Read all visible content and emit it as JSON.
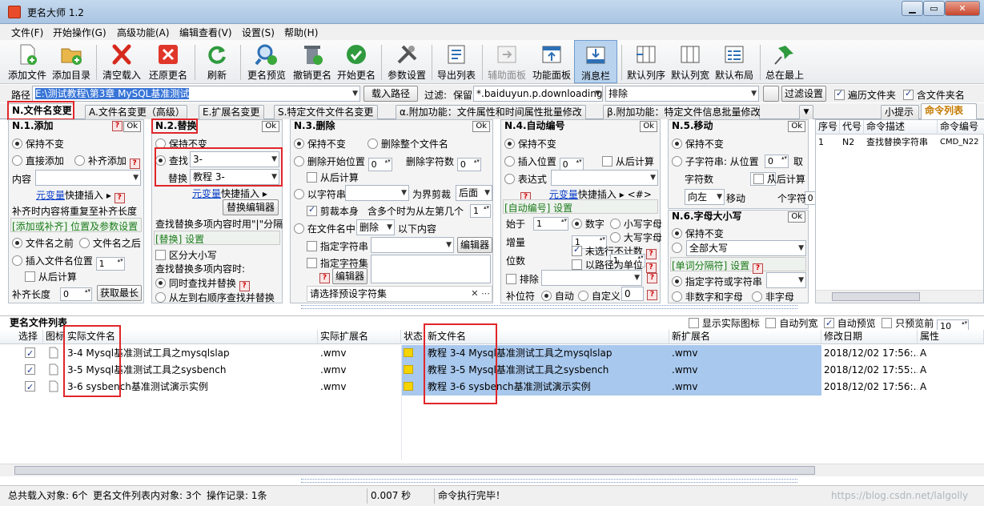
{
  "window": {
    "title": "更名大师 1.2",
    "min": "▁",
    "max": "▭",
    "close": "✕"
  },
  "menu": [
    "文件(F)",
    "开始操作(G)",
    "高级功能(A)",
    "编辑查看(V)",
    "设置(S)",
    "帮助(H)"
  ],
  "toolbar": [
    {
      "label": "添加文件",
      "icon": "add-file-icon"
    },
    {
      "label": "添加目录",
      "icon": "add-folder-icon"
    },
    {
      "label": "清空载入",
      "icon": "clear-icon"
    },
    {
      "label": "还原更名",
      "icon": "undo-rename-icon"
    },
    {
      "label": "刷新",
      "icon": "refresh-icon"
    },
    {
      "label": "更名预览",
      "icon": "preview-icon"
    },
    {
      "label": "撤销更名",
      "icon": "trash-icon"
    },
    {
      "label": "开始更名",
      "icon": "start-icon"
    },
    {
      "label": "参数设置",
      "icon": "tools-icon"
    },
    {
      "label": "导出列表",
      "icon": "export-icon"
    },
    {
      "label": "辅助面板",
      "icon": "aux-panel-icon"
    },
    {
      "label": "功能面板",
      "icon": "func-panel-icon"
    },
    {
      "label": "消息栏",
      "icon": "message-icon"
    },
    {
      "label": "默认列序",
      "icon": "col-order-icon"
    },
    {
      "label": "默认列宽",
      "icon": "col-width-icon"
    },
    {
      "label": "默认布局",
      "icon": "layout-icon"
    },
    {
      "label": "总在最上",
      "icon": "pin-icon"
    }
  ],
  "pathbar": {
    "path_label": "路径",
    "path_value": "E:\\测试教程\\第3章 MySQL基准测试",
    "load_path": "载入路径",
    "filter_label": "过滤:",
    "keep_label": "保留",
    "keep_value": "*.baiduyun.p.downloading",
    "exclude_value": "排除",
    "filter_btn": "过滤设置",
    "traverse": "遍历文件夹",
    "include_dir": "含文件夹名"
  },
  "tabs": [
    "N.文件名变更",
    "A.文件名变更（高级）",
    "E.扩展名变更",
    "S.特定文件文件名变更",
    "α.附加功能：文件属性和时间属性批量修改",
    "β.附加功能：特定文件信息批量修改"
  ],
  "right_tabs": [
    "小提示",
    "命令列表"
  ],
  "p1": {
    "title": "N.1.添加",
    "ok": "Ok",
    "q": "?",
    "keep": "保持不变",
    "direct": "直接添加",
    "pad": "补齐添加",
    "content": "内容",
    "var_link": "元变量",
    "quick_insert": "快捷插入",
    "repeat_note": "补齐时内容将重复至补齐长度",
    "pos_title": "[添加或补齐] 位置及参数设置",
    "before": "文件名之前",
    "after": "文件名之后",
    "insert_pos": "插入文件名位置",
    "insert_val": "1",
    "from_back": "从后计算",
    "pad_len": "补齐长度",
    "pad_val": "0",
    "get_max": "获取最长"
  },
  "p2": {
    "title": "N.2.替换",
    "ok": "Ok",
    "keep": "保持不变",
    "find": "查找",
    "find_val": "3-",
    "replace": "替换",
    "replace_val": "教程 3-",
    "var_link": "元变量",
    "quick_insert": "快捷插入",
    "editor": "替换编辑器",
    "multi_note": "查找替换多项内容时用\"|\"分隔",
    "settings_title": "[替换] 设置",
    "case": "区分大小写",
    "multi_when": "查找替换多项内容时:",
    "simul": "同时查找并替换",
    "seq": "从左到右顺序查找并替换"
  },
  "p3": {
    "title": "N.3.删除",
    "ok": "Ok",
    "keep": "保持不变",
    "del_all": "删除整个文件名",
    "del_start": "删除开始位置",
    "start_val": "0",
    "del_count": "删除字符数",
    "count_val": "0",
    "from_back": "从后计算",
    "by_str": "以字符串",
    "by_str_sel": "",
    "cut_label": "为界剪裁",
    "cut_dir": "后面",
    "cut_self": "剪裁本身",
    "multi_note": "含多个时为从左第几个",
    "multi_val": "1",
    "in_name": "在文件名中",
    "in_name_sel": "删除",
    "below": "以下内容",
    "spec_str": "指定字符串",
    "editor": "编辑器",
    "spec_set": "指定字符集",
    "editor2": "编辑器",
    "preset": "请选择预设字符集"
  },
  "p4": {
    "title": "N.4.自动编号",
    "ok": "Ok",
    "keep": "保持不变",
    "insert_pos": "插入位置",
    "insert_val": "0",
    "from_back": "从后计算",
    "expr": "表达式",
    "var_link": "元变量",
    "quick_insert": "快捷插入",
    "hash": "<#>",
    "settings_title": "[自动编号] 设置",
    "start": "始于",
    "start_val": "1",
    "inc": "增量",
    "inc_val": "1",
    "digits": "位数",
    "digits_val": "1",
    "num": "数字",
    "lower": "小写字母",
    "upper": "大写字母",
    "skip_unselected": "未选行不计数",
    "path_unit": "以路径为单位",
    "exclude": "排除",
    "pad_char": "补位符",
    "auto": "自动",
    "custom": "自定义",
    "custom_val": "0"
  },
  "p5": {
    "title": "N.5.移动",
    "ok": "Ok",
    "keep": "保持不变",
    "substr": "子字符串: 从位置",
    "substr_val": "0",
    "take": "取",
    "chars": "字符数",
    "chars_val": "0",
    "from_back": "从后计算",
    "dir": "向左",
    "move": "移动",
    "move_val": "0",
    "unit": "个字符"
  },
  "p6": {
    "title": "N.6.字母大小写",
    "ok": "Ok",
    "keep": "保持不变",
    "case_sel": "全部大写",
    "sep_title": "[单词分隔符] 设置",
    "spec": "指定字符或字符串",
    "non_alnum": "非数字和字母",
    "non_alpha": "非字母"
  },
  "cmd": {
    "headers": [
      "序号",
      "代号",
      "命令描述",
      "命令编号"
    ],
    "rows": [
      {
        "no": "1",
        "code": "N2",
        "desc": "查找替换字符串",
        "id": "CMD_N22"
      }
    ]
  },
  "filelist": {
    "title": "更名文件列表",
    "opts": [
      "显示实际图标",
      "自动列宽",
      "自动预览",
      "只预览前"
    ],
    "preview_n": "10",
    "headers": [
      "选择",
      "图标",
      "实际文件名",
      "实际扩展名",
      "状态",
      "新文件名",
      "新扩展名",
      "修改日期",
      "属性"
    ],
    "rows": [
      {
        "name": "3-4 Mysql基准测试工具之mysqlslap",
        "ext": ".wmv",
        "new": "教程 3-4 Mysql基准测试工具之mysqlslap",
        "newext": ".wmv",
        "date": "2018/12/02 17:56:...",
        "attr": "A"
      },
      {
        "name": "3-5 Mysql基准测试工具之sysbench",
        "ext": ".wmv",
        "new": "教程 3-5 Mysql基准测试工具之sysbench",
        "newext": ".wmv",
        "date": "2018/12/02 17:55:...",
        "attr": "A"
      },
      {
        "name": "3-6 sysbench基准测试演示实例",
        "ext": ".wmv",
        "new": "教程 3-6 sysbench基准测试演示实例",
        "newext": ".wmv",
        "date": "2018/12/02 17:56:...",
        "attr": "A"
      }
    ]
  },
  "status": {
    "loaded": "总共载入对象: 6个",
    "inlist": "更名文件列表内对象: 3个",
    "log": "操作记录: 1条",
    "time": "0.007 秒",
    "msg": "命令执行完毕！",
    "watermark": "https://blog.csdn.net/lalgolly"
  },
  "colors": {
    "accent": "#0a3fc9",
    "highlight": "#e0262a",
    "selection": "#a8c8ee"
  }
}
